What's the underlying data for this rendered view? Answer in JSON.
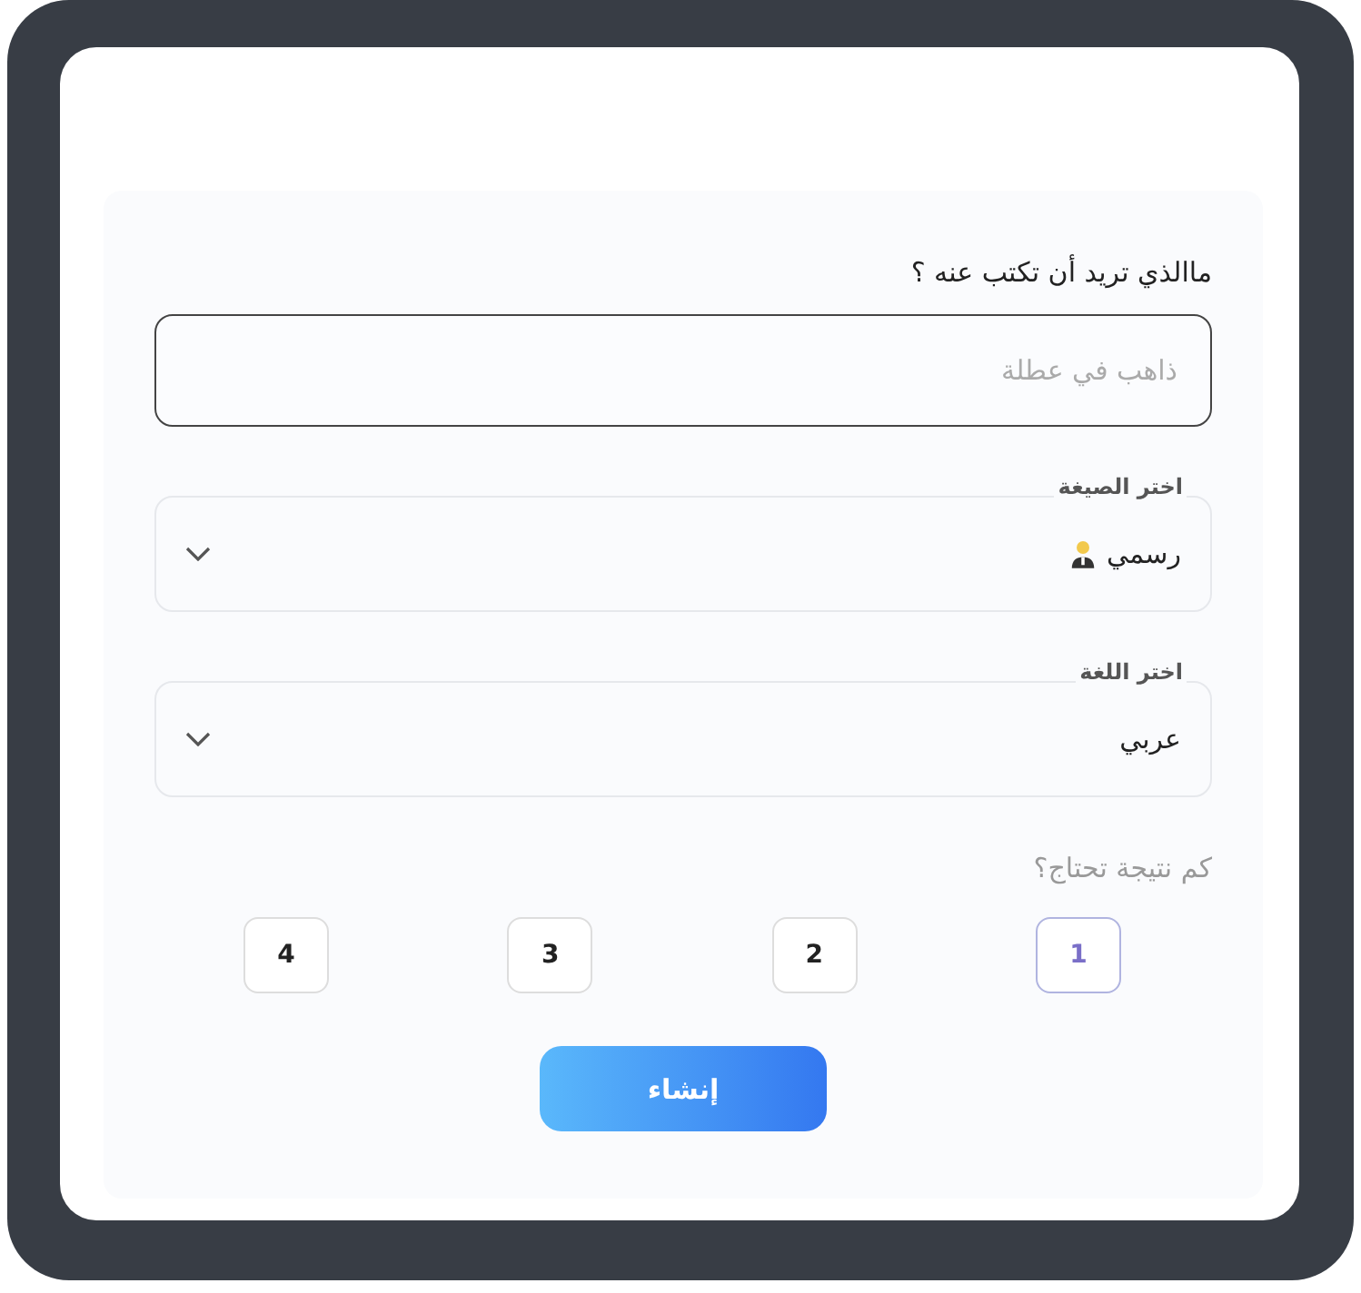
{
  "topic": {
    "label": "ماالذي تريد أن تكتب عنه ؟",
    "placeholder": "ذاهب في عطلة"
  },
  "selects": [
    {
      "label": "اختر الصيغة",
      "value": "رسمي",
      "has_icon": true
    },
    {
      "label": "اختر اللغة",
      "value": "عربي",
      "has_icon": false
    }
  ],
  "count": {
    "label": "كم نتيجة تحتاج؟",
    "options": [
      {
        "label": "1",
        "selected": true
      },
      {
        "label": "2",
        "selected": false
      },
      {
        "label": "3",
        "selected": false
      },
      {
        "label": "4",
        "selected": false
      }
    ]
  },
  "submit": "إنشاء"
}
